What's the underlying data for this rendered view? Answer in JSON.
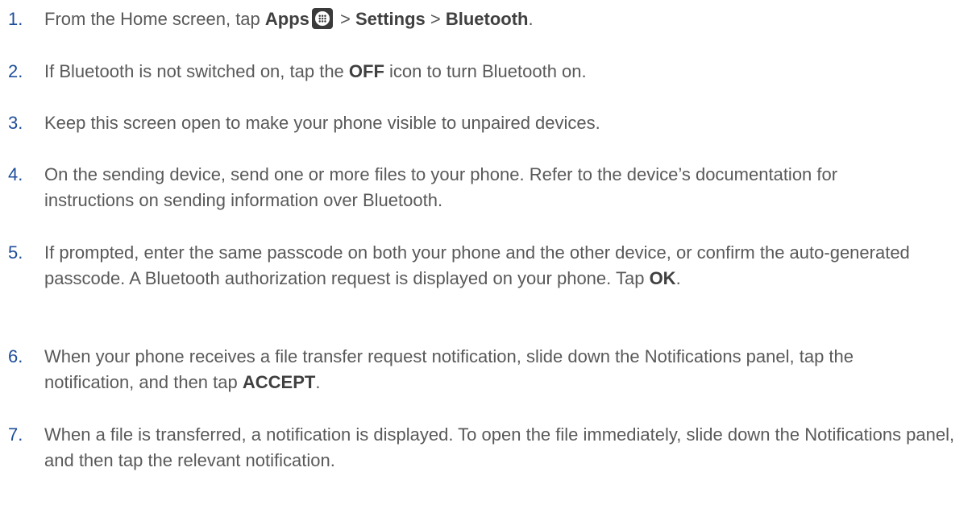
{
  "steps": [
    {
      "num": "1.",
      "parts": [
        "From the Home screen, tap ",
        "Apps",
        " > ",
        "Settings",
        " > ",
        "Bluetooth",
        "."
      ]
    },
    {
      "num": "2.",
      "parts": [
        "If Bluetooth is not switched on, tap the ",
        "OFF",
        " icon to turn Bluetooth on."
      ]
    },
    {
      "num": "3.",
      "text": "Keep this screen open to make your phone visible to unpaired devices."
    },
    {
      "num": "4.",
      "text": "On the sending device, send one or more files to your phone. Refer to the device’s documentation for instructions on sending information over Bluetooth."
    },
    {
      "num": "5.",
      "parts": [
        "If prompted, enter the same passcode on both your phone and the other device, or confirm the auto-generated passcode. A Bluetooth authorization request is displayed on your phone. Tap ",
        "OK",
        "."
      ]
    },
    {
      "num": "6.",
      "parts": [
        "When your phone receives a file transfer request notification, slide down the Notifications panel, tap the notification, and then tap ",
        "ACCEPT",
        "."
      ]
    },
    {
      "num": "7.",
      "text": "When a file is transferred, a notification is displayed. To open the file immediately, slide down the Notifications panel, and then tap the relevant notification."
    }
  ],
  "icons": {
    "apps": "apps-grid-icon"
  },
  "colors": {
    "number": "#1f4e9a",
    "text": "#595959",
    "bold": "#404040"
  }
}
